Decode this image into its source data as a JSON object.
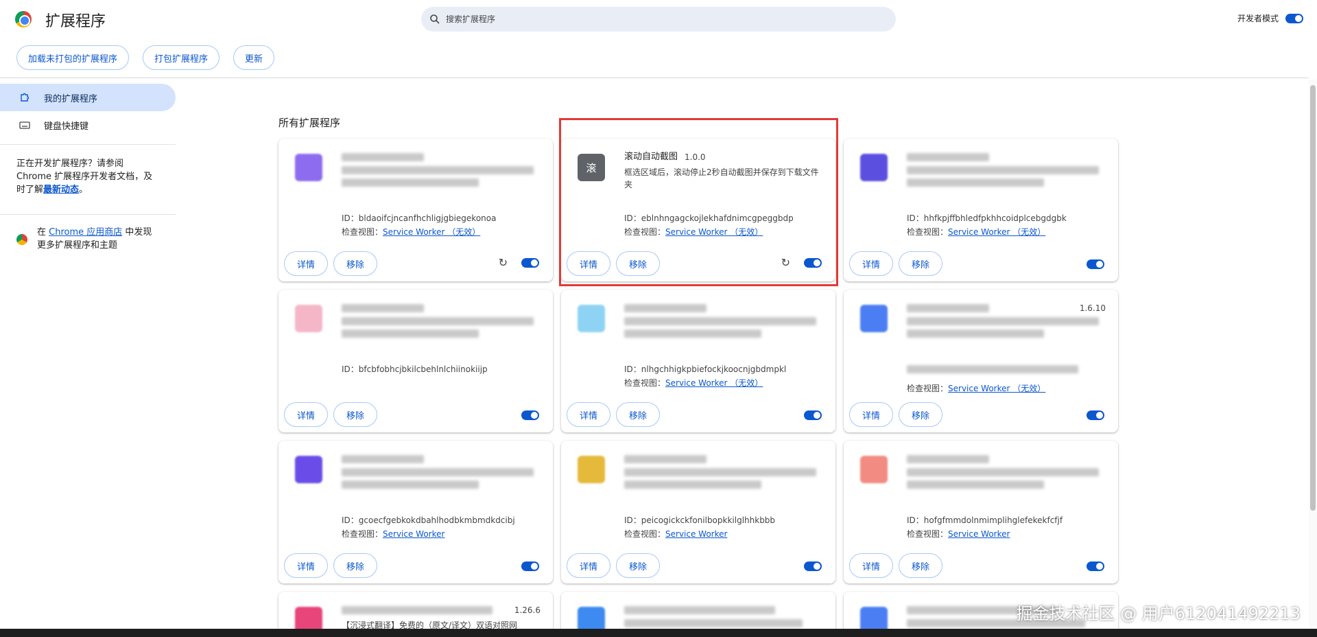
{
  "header": {
    "title": "扩展程序",
    "search_placeholder": "搜索扩展程序",
    "dev_mode_label": "开发者模式",
    "dev_mode_on": true
  },
  "toolbar": {
    "load_unpacked": "加载未打包的扩展程序",
    "pack": "打包扩展程序",
    "update": "更新"
  },
  "sidebar": {
    "items": [
      {
        "label": "我的扩展程序",
        "active": true,
        "icon": "extension-icon"
      },
      {
        "label": "键盘快捷键",
        "active": false,
        "icon": "keyboard-icon"
      }
    ],
    "dev_text_before": "正在开发扩展程序？请参阅 Chrome 扩展程序开发者文档，及时了解",
    "dev_text_link": "最新动态",
    "dev_text_after": "。",
    "store_text_before": "在 ",
    "store_link": "Chrome 应用商店",
    "store_text_after": " 中发现更多扩展程序和主题"
  },
  "section_title": "所有扩展程序",
  "labels": {
    "id_prefix": "ID：",
    "inspect_prefix": "检查视图：",
    "details": "详情",
    "remove": "移除"
  },
  "cards": [
    {
      "name": "",
      "version": "",
      "desc": "",
      "id": "bldaoifcjncanfhchligjgbiegekonoa",
      "inspect": "Service Worker （无效）",
      "reload": true,
      "enabled": true,
      "icon_color": "#8e6cf0"
    },
    {
      "name": "滚动自动截图",
      "version": "1.0.0",
      "desc": "框选区域后，滚动停止2秒自动截图并保存到下载文件夹",
      "id": "eblnhngagckojlekhafdnimcgpeggbdp",
      "inspect": "Service Worker （无效）",
      "reload": true,
      "enabled": true,
      "icon_color": "#5f6368",
      "icon_char": "滚"
    },
    {
      "name": "",
      "version": "",
      "desc": "",
      "id": "hhfkpjffbhledfpkhhcoidplcebgdgbk",
      "inspect": "Service Worker （无效）",
      "reload": false,
      "enabled": true,
      "icon_color": "#5b4fe0"
    },
    {
      "name": "",
      "version": "",
      "desc": "",
      "id": "bfcbfobhcjbkilcbehlnlchiinokiijp",
      "inspect": "",
      "reload": false,
      "enabled": true,
      "icon_color": "#f5b6c8"
    },
    {
      "name": "",
      "version": "",
      "desc": "",
      "id": "nlhgchhigkpbiefockjkoocnjgbdmpkl",
      "inspect": "Service Worker （无效）",
      "reload": false,
      "enabled": true,
      "icon_color": "#8fd3f4"
    },
    {
      "name": "",
      "version": "1.6.10",
      "desc": "",
      "id": "",
      "inspect": "Service Worker （无效）",
      "reload": false,
      "enabled": true,
      "icon_color": "#4c7ef3"
    },
    {
      "name": "",
      "version": "",
      "desc": "",
      "id": "gcoecfgebkokdbahlhodbkmbmdkdcibj",
      "inspect": "Service Worker",
      "reload": false,
      "enabled": true,
      "icon_color": "#6a4de8"
    },
    {
      "name": "",
      "version": "",
      "desc": "",
      "id": "peicogickckfonilbopkkilglhhkbbb",
      "inspect": "Service Worker",
      "reload": false,
      "enabled": true,
      "icon_color": "#e5b93a"
    },
    {
      "name": "",
      "version": "",
      "desc": "",
      "id": "hofgfmmdolnmimplihglefekekfcfjf",
      "inspect": "Service Worker",
      "reload": false,
      "enabled": true,
      "icon_color": "#f28b82"
    }
  ],
  "partial_cards": [
    {
      "version": "1.26.6",
      "desc": "【沉浸式翻译】免费的（原文/译文）双语对照网",
      "icon_color": "#e8457a"
    },
    {
      "version": "",
      "desc": "",
      "icon_color": "#3d8af0"
    },
    {
      "version": "",
      "desc": "",
      "icon_color": "#4c7ef3"
    }
  ],
  "watermark": "掘金技术社区 @ 用户612041492213"
}
